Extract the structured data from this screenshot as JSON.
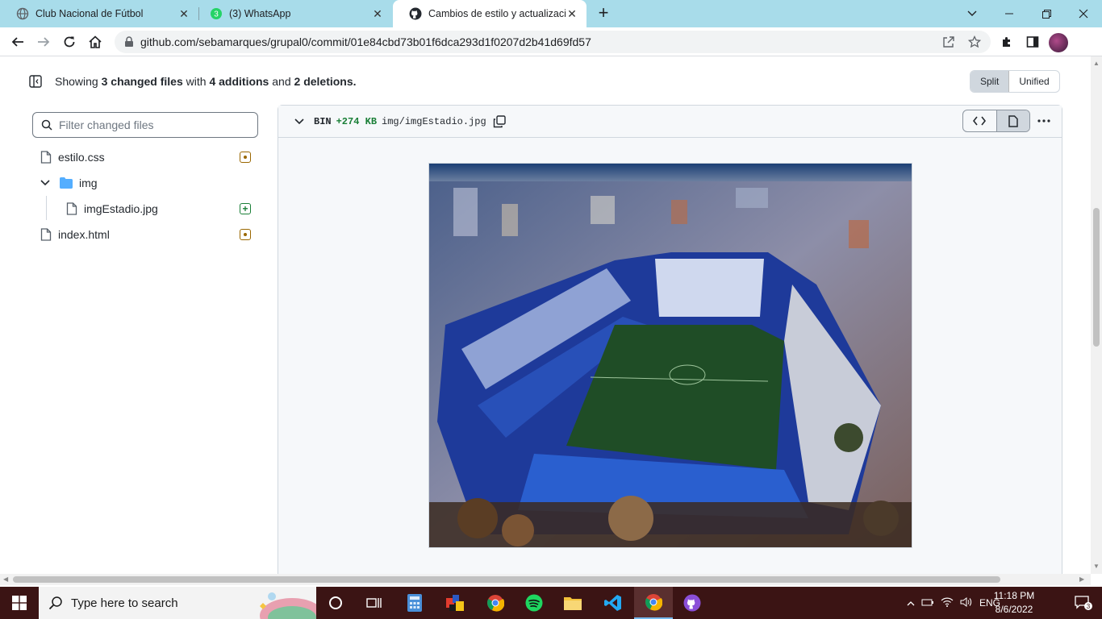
{
  "browser": {
    "tabs": [
      {
        "title": "Club Nacional de Fútbol",
        "icon": "globe-icon",
        "active": false
      },
      {
        "title": "(3) WhatsApp",
        "icon": "whatsapp-icon",
        "badge": "3",
        "active": false
      },
      {
        "title": "Cambios de estilo y actualización",
        "icon": "github-icon",
        "active": true
      }
    ],
    "url": "github.com/sebamarques/grupal0/commit/01e84cbd73b01f6dca293d1f0207d2b41d69fd57"
  },
  "summary": {
    "prefix": "Showing",
    "files_count": "3",
    "files_label": "changed files",
    "with": "with",
    "additions_count": "4",
    "additions_label": "additions",
    "and": "and",
    "deletions_count": "2",
    "deletions_label": "deletions."
  },
  "view_toggle": {
    "split": "Split",
    "unified": "Unified",
    "selected": "Split"
  },
  "file_tree": {
    "filter_placeholder": "Filter changed files",
    "items": [
      {
        "name": "estilo.css",
        "type": "file",
        "status": "modified"
      },
      {
        "name": "img",
        "type": "folder",
        "expanded": true
      },
      {
        "name": "imgEstadio.jpg",
        "type": "file",
        "status": "added"
      },
      {
        "name": "index.html",
        "type": "file",
        "status": "modified"
      }
    ]
  },
  "diff": {
    "kind": "BIN",
    "size_change": "+274 KB",
    "path": "img/imgEstadio.jpg"
  },
  "taskbar": {
    "search_placeholder": "Type here to search",
    "language": "ENG",
    "time": "11:18 PM",
    "date": "8/6/2022",
    "notification_count": "3"
  }
}
